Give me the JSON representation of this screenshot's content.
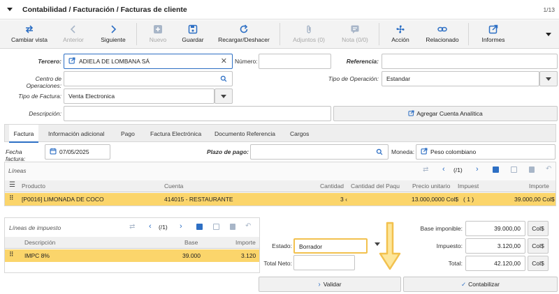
{
  "header": {
    "title": "Contabilidad / Facturación / Facturas de cliente",
    "record_count": "1/13"
  },
  "toolbar": {
    "items": [
      {
        "label": "Cambiar vista",
        "icon": "swap-icon"
      },
      {
        "label": "Anterior",
        "icon": "chevron-left-icon"
      },
      {
        "label": "Siguiente",
        "icon": "chevron-right-icon"
      },
      {
        "label": "Nuevo",
        "icon": "plus-icon"
      },
      {
        "label": "Guardar",
        "icon": "save-icon"
      },
      {
        "label": "Recargar/Deshacer",
        "icon": "reload-icon"
      },
      {
        "label": "Adjuntos (0)",
        "icon": "paperclip-icon"
      },
      {
        "label": "Nota (0/0)",
        "icon": "note-icon"
      },
      {
        "label": "Acción",
        "icon": "fan-icon"
      },
      {
        "label": "Relacionado",
        "icon": "link-icon"
      },
      {
        "label": "Informes",
        "icon": "external-link-icon"
      }
    ]
  },
  "form": {
    "tercero_label": "Tercero:",
    "tercero_value": "ADIELA DE LOMBANA SÁ",
    "numero_label": "Número:",
    "numero_value": "",
    "referencia_label": "Referencia:",
    "referencia_value": "",
    "centro_label": "Centro de Operaciones:",
    "centro_value": "",
    "tipo_operacion_label": "Tipo de Operación:",
    "tipo_operacion_value": "Estandar",
    "tipo_factura_label": "Tipo de Factura:",
    "tipo_factura_value": "Venta Electronica",
    "descripcion_label": "Descripción:",
    "descripcion_value": "",
    "agregar_cuenta_label": "Agregar Cuenta Analítica"
  },
  "tabs": [
    "Factura",
    "Información adicional",
    "Pago",
    "Factura Electrónica",
    "Documento Referencia",
    "Cargos"
  ],
  "factura": {
    "fecha_label": "Fecha factura:",
    "fecha_value": "07/05/2025",
    "plazo_label": "Plazo de pago:",
    "plazo_value": "",
    "moneda_label": "Moneda:",
    "moneda_value": "Peso colombiano"
  },
  "lineas": {
    "title": "Líneas",
    "pager": "(/1)",
    "columns": [
      "Producto",
      "Cuenta",
      "Cantidad",
      "Cantidad del Paqu",
      "Precio unitario",
      "Impuest",
      "Importe"
    ],
    "rows": [
      {
        "producto": "[P0016] LIMONADA DE COCO",
        "cuenta": "414015 - RESTAURANTE",
        "cantidad": "3 ‹",
        "cantidad_paq": "",
        "precio": "13.000,0000 Col$",
        "impuestos": "( 1 )",
        "importe": "39.000,00 Col$"
      }
    ]
  },
  "impuestos": {
    "title": "Líneas de impuesto",
    "pager": "(/1)",
    "columns": [
      "Descripción",
      "Base",
      "Importe"
    ],
    "rows": [
      {
        "descripcion": "IMPC 8%",
        "base": "39.000",
        "importe": "3.120"
      }
    ]
  },
  "estado": {
    "label": "Estado:",
    "value": "Borrador",
    "total_neto_label": "Total Neto:",
    "total_neto_value": ""
  },
  "totales": {
    "base_label": "Base imponible:",
    "base_value": "39.000,00",
    "base_currency": "Col$",
    "impuesto_label": "Impuesto:",
    "impuesto_value": "3.120,00",
    "impuesto_currency": "Col$",
    "total_label": "Total:",
    "total_value": "42.120,00",
    "total_currency": "Col$"
  },
  "actions": {
    "validar": "Validar",
    "contabilizar": "Contabilizar"
  },
  "colors": {
    "accent": "#2d6fc4",
    "selected_row": "#fbd56b",
    "highlight": "#f2c14e"
  }
}
